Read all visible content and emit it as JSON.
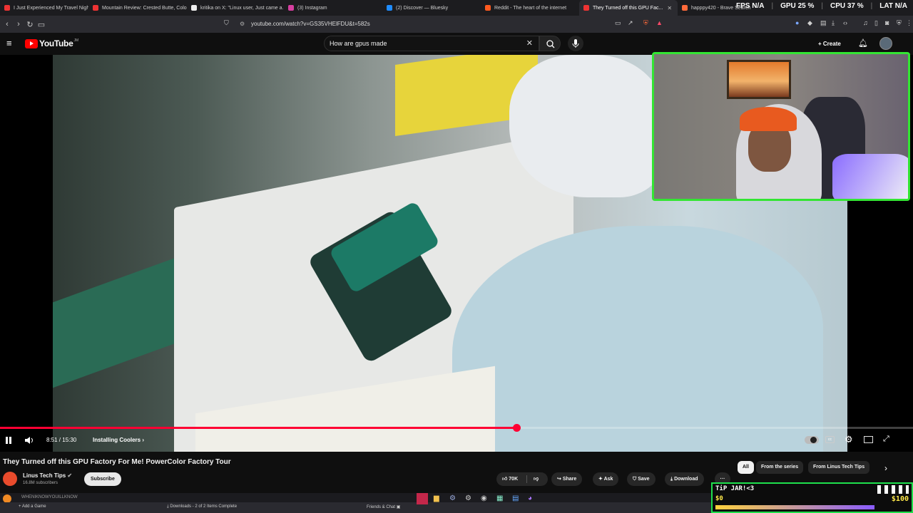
{
  "browser": {
    "tabs": [
      {
        "label": "I Just Experienced My Travel Nightm...",
        "color": "#e33"
      },
      {
        "label": "Mountain Review: Crested Butte, Colo...",
        "color": "#e33"
      },
      {
        "label": "kritika on X: \"Linux user, Just came a...",
        "color": "#eee"
      },
      {
        "label": "(3) Instagram",
        "color": "#d63fa0"
      },
      {
        "label": "(2) Discover — Bluesky",
        "color": "#1f8cff"
      },
      {
        "label": "Reddit - The heart of the internet",
        "color": "#ff5a1f"
      },
      {
        "label": "They Turned off this GPU Fac...",
        "color": "#e33",
        "active": true
      },
      {
        "label": "happpy420 - Brave Search",
        "color": "#ff6a3a"
      }
    ],
    "url": "youtube.com/watch?v=GS35VHElFDU&t=582s",
    "stats": {
      "fps_label": "FPS",
      "fps_value": "N/A",
      "gpu_label": "GPU",
      "gpu_value": "25",
      "cpu_label": "CPU",
      "cpu_value": "37",
      "lat_label": "LAT",
      "lat_value": "N/A"
    }
  },
  "youtube": {
    "logo": "YouTube",
    "logo_sup": "JM",
    "search_value": "How are gpus made",
    "create_label": "Create",
    "video": {
      "time": "8:51 / 15:30",
      "chapter": "Installing Coolers",
      "progress": 0.5656
    },
    "title": "They Turned off this GPU Factory For Me! PowerColor Factory Tour",
    "channel": "Linus Tech Tips",
    "subscribers": "16.8M subscribers",
    "subscribe_label": "Subscribe",
    "likes": "70K",
    "actions": {
      "share": "Share",
      "ask": "Ask",
      "save": "Save",
      "download": "Download"
    },
    "chips": [
      "All",
      "From the series",
      "From Linus Tech Tips"
    ]
  },
  "taskbar": {
    "now_playing": "WHENIKNOWYOUILLKNOW",
    "add_game": "Add a Game",
    "downloads": "Downloads - 2 of 2 Items Complete",
    "friends": "Friends & Chat"
  },
  "overlay": {
    "tip_label": "TiP JAR!<3",
    "tip_amount": "$0",
    "tip_goal": "$100",
    "accent": "#33e533"
  }
}
